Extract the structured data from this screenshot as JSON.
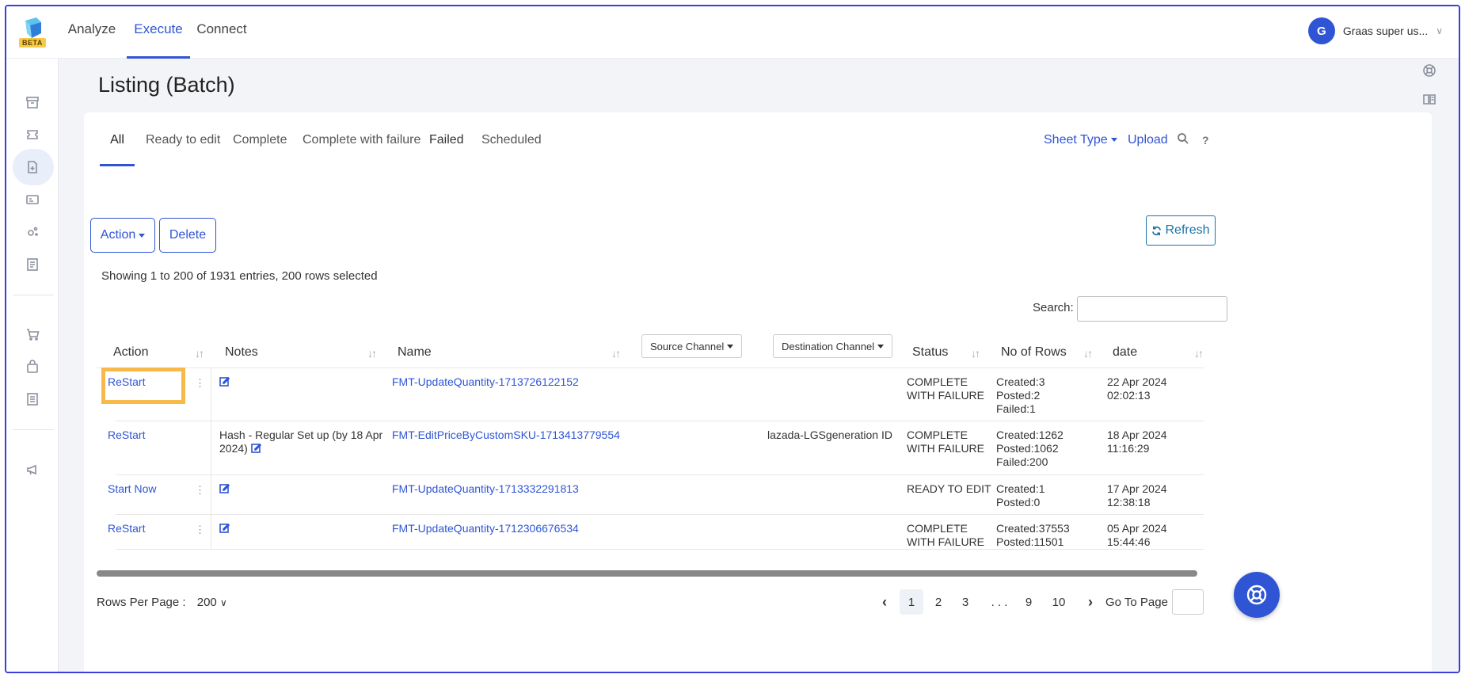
{
  "brand": {
    "beta_label": "BETA"
  },
  "topnav": {
    "tabs": [
      {
        "label": "Analyze",
        "active": false
      },
      {
        "label": "Execute",
        "active": true
      },
      {
        "label": "Connect",
        "active": false
      }
    ],
    "user": {
      "initial": "G",
      "name": "Graas super us..."
    }
  },
  "sidebar": {
    "icons": [
      "archive-icon",
      "ticket-icon",
      "document-icon",
      "id-card-icon",
      "settings-cluster-icon",
      "list-icon",
      "cart-icon",
      "bag-icon",
      "file-list-icon",
      "megaphone-icon"
    ],
    "active_icon": "document-icon"
  },
  "page": {
    "title": "Listing (Batch)",
    "right_rail_icons": [
      "help-circle-icon",
      "book-icon"
    ]
  },
  "status_tabs": [
    {
      "label": "All",
      "active": true
    },
    {
      "label": "Ready to edit",
      "active": false
    },
    {
      "label": "Complete",
      "active": false
    },
    {
      "label": "Complete with failure",
      "active": false
    },
    {
      "label": "Failed",
      "active": false
    },
    {
      "label": "Scheduled",
      "active": false
    }
  ],
  "toolbar": {
    "sheet_type_label": "Sheet Type",
    "upload_label": "Upload",
    "help_label": "?",
    "action_label": "Action",
    "delete_label": "Delete",
    "refresh_label": "Refresh"
  },
  "summary": "Showing 1 to 200 of 1931 entries, 200 rows selected",
  "search": {
    "label": "Search:",
    "value": ""
  },
  "table": {
    "columns": {
      "action": "Action",
      "notes": "Notes",
      "name": "Name",
      "source_channel": "Source Channel",
      "destination_channel": "Destination Channel",
      "status": "Status",
      "rows": "No of Rows",
      "date": "date"
    },
    "rows": [
      {
        "action": "ReStart",
        "notes": "",
        "name": "FMT-UpdateQuantity-1713726122152",
        "source": "",
        "destination": "",
        "status_1": "COMPLETE",
        "status_2": "WITH FAILURE",
        "counts": [
          "Created:3",
          "Posted:2",
          "Failed:1"
        ],
        "date_1": "22 Apr 2024",
        "date_2": "02:02:13"
      },
      {
        "action": "ReStart",
        "notes": "Hash - Regular Set up (by 18 Apr",
        "notes_2": "2024)",
        "name": "FMT-EditPriceByCustomSKU-1713413779554",
        "source": "",
        "destination": "lazada-LGSgeneration ID",
        "status_1": "COMPLETE",
        "status_2": "WITH FAILURE",
        "counts": [
          "Created:1262",
          "Posted:1062",
          "Failed:200"
        ],
        "date_1": "18 Apr 2024",
        "date_2": "11:16:29"
      },
      {
        "action": "Start Now",
        "notes": "",
        "name": "FMT-UpdateQuantity-1713332291813",
        "source": "",
        "destination": "",
        "status_1": "READY TO EDIT",
        "status_2": "",
        "counts": [
          "Created:1",
          "Posted:0"
        ],
        "date_1": "17 Apr 2024",
        "date_2": "12:38:18"
      },
      {
        "action": "ReStart",
        "notes": "",
        "name": "FMT-UpdateQuantity-1712306676534",
        "source": "",
        "destination": "",
        "status_1": "COMPLETE",
        "status_2": "WITH FAILURE",
        "counts": [
          "Created:37553",
          "Posted:11501"
        ],
        "date_1": "05 Apr 2024",
        "date_2": "15:44:46"
      }
    ]
  },
  "pagination": {
    "rows_per_page_label": "Rows Per Page :",
    "rows_per_page_value": "200",
    "pages": [
      "1",
      "2",
      "3",
      ". . .",
      "9",
      "10"
    ],
    "active_page": "1",
    "goto_label": "Go To Page :"
  },
  "colors": {
    "accent": "#2f55d4",
    "highlight": "#f6b94a",
    "refresh": "#1b73a8"
  }
}
